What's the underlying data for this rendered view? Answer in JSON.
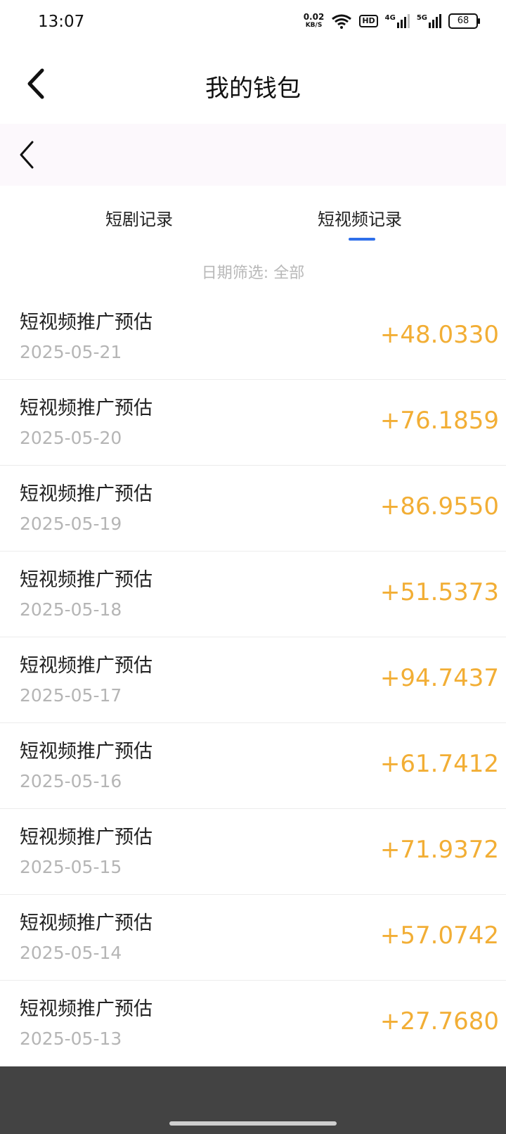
{
  "status_bar": {
    "time": "13:07",
    "net_speed_value": "0.02",
    "net_speed_unit": "KB/S",
    "hd_badge": "HD",
    "signal_4g": "4G",
    "signal_5g": "5G",
    "battery": "68"
  },
  "header": {
    "title": "我的钱包",
    "back_icon": "chevron-left-icon"
  },
  "sub_header": {
    "back_icon": "chevron-left-icon"
  },
  "tabs": [
    {
      "label": "短剧记录",
      "active": false
    },
    {
      "label": "短视频记录",
      "active": true
    }
  ],
  "accent_color": "#2f6fea",
  "amount_color": "#f2ae35",
  "filter": {
    "label": "日期筛选:",
    "value": "全部"
  },
  "records": [
    {
      "title": "短视频推广预估",
      "date": "2025-05-21",
      "amount": "+48.0330"
    },
    {
      "title": "短视频推广预估",
      "date": "2025-05-20",
      "amount": "+76.1859"
    },
    {
      "title": "短视频推广预估",
      "date": "2025-05-19",
      "amount": "+86.9550"
    },
    {
      "title": "短视频推广预估",
      "date": "2025-05-18",
      "amount": "+51.5373"
    },
    {
      "title": "短视频推广预估",
      "date": "2025-05-17",
      "amount": "+94.7437"
    },
    {
      "title": "短视频推广预估",
      "date": "2025-05-16",
      "amount": "+61.7412"
    },
    {
      "title": "短视频推广预估",
      "date": "2025-05-15",
      "amount": "+71.9372"
    },
    {
      "title": "短视频推广预估",
      "date": "2025-05-14",
      "amount": "+57.0742"
    },
    {
      "title": "短视频推广预估",
      "date": "2025-05-13",
      "amount": "+27.7680"
    }
  ]
}
